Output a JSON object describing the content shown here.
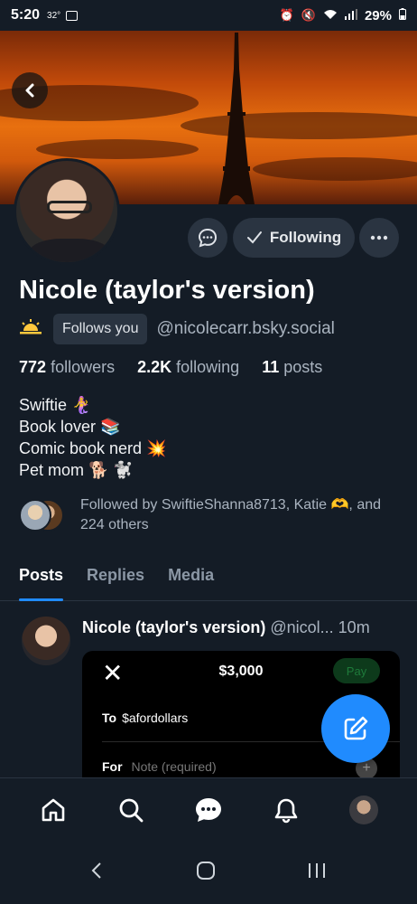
{
  "status_bar": {
    "time": "5:20",
    "temp": "32°",
    "battery": "29%",
    "icons": [
      "image-icon",
      "alarm-icon",
      "mute-icon",
      "wifi-icon",
      "signal-icon",
      "battery-icon"
    ]
  },
  "profile": {
    "display_name": "Nicole (taylor's version)",
    "follows_you_label": "Follows you",
    "handle": "@nicolecarr.bsky.social",
    "followers_count": "772",
    "followers_label": "followers",
    "following_count": "2.2K",
    "following_label": "following",
    "posts_count": "11",
    "posts_label": "posts",
    "follow_button_label": "Following",
    "bio": [
      "Swiftie 🧜‍♀️",
      "Book lover 📚",
      "Comic book nerd 💥",
      "Pet mom 🐕 🐩"
    ],
    "followed_by_text": "Followed by SwiftieShanna8713, Katie 🫶, and 224 others"
  },
  "tabs": [
    "Posts",
    "Replies",
    "Media"
  ],
  "post": {
    "author": "Nicole (taylor's version)",
    "handle": "@nicol...",
    "time": "10m",
    "embed": {
      "amount": "$3,000",
      "pay_label": "Pay",
      "to_label": "To",
      "to_value": "$afordollars",
      "for_label": "For",
      "for_placeholder": "Note (required)"
    }
  },
  "colors": {
    "background": "#141c26",
    "accent": "#208bfe",
    "button_bg": "#2a3441",
    "muted_text": "#aab4c0"
  }
}
